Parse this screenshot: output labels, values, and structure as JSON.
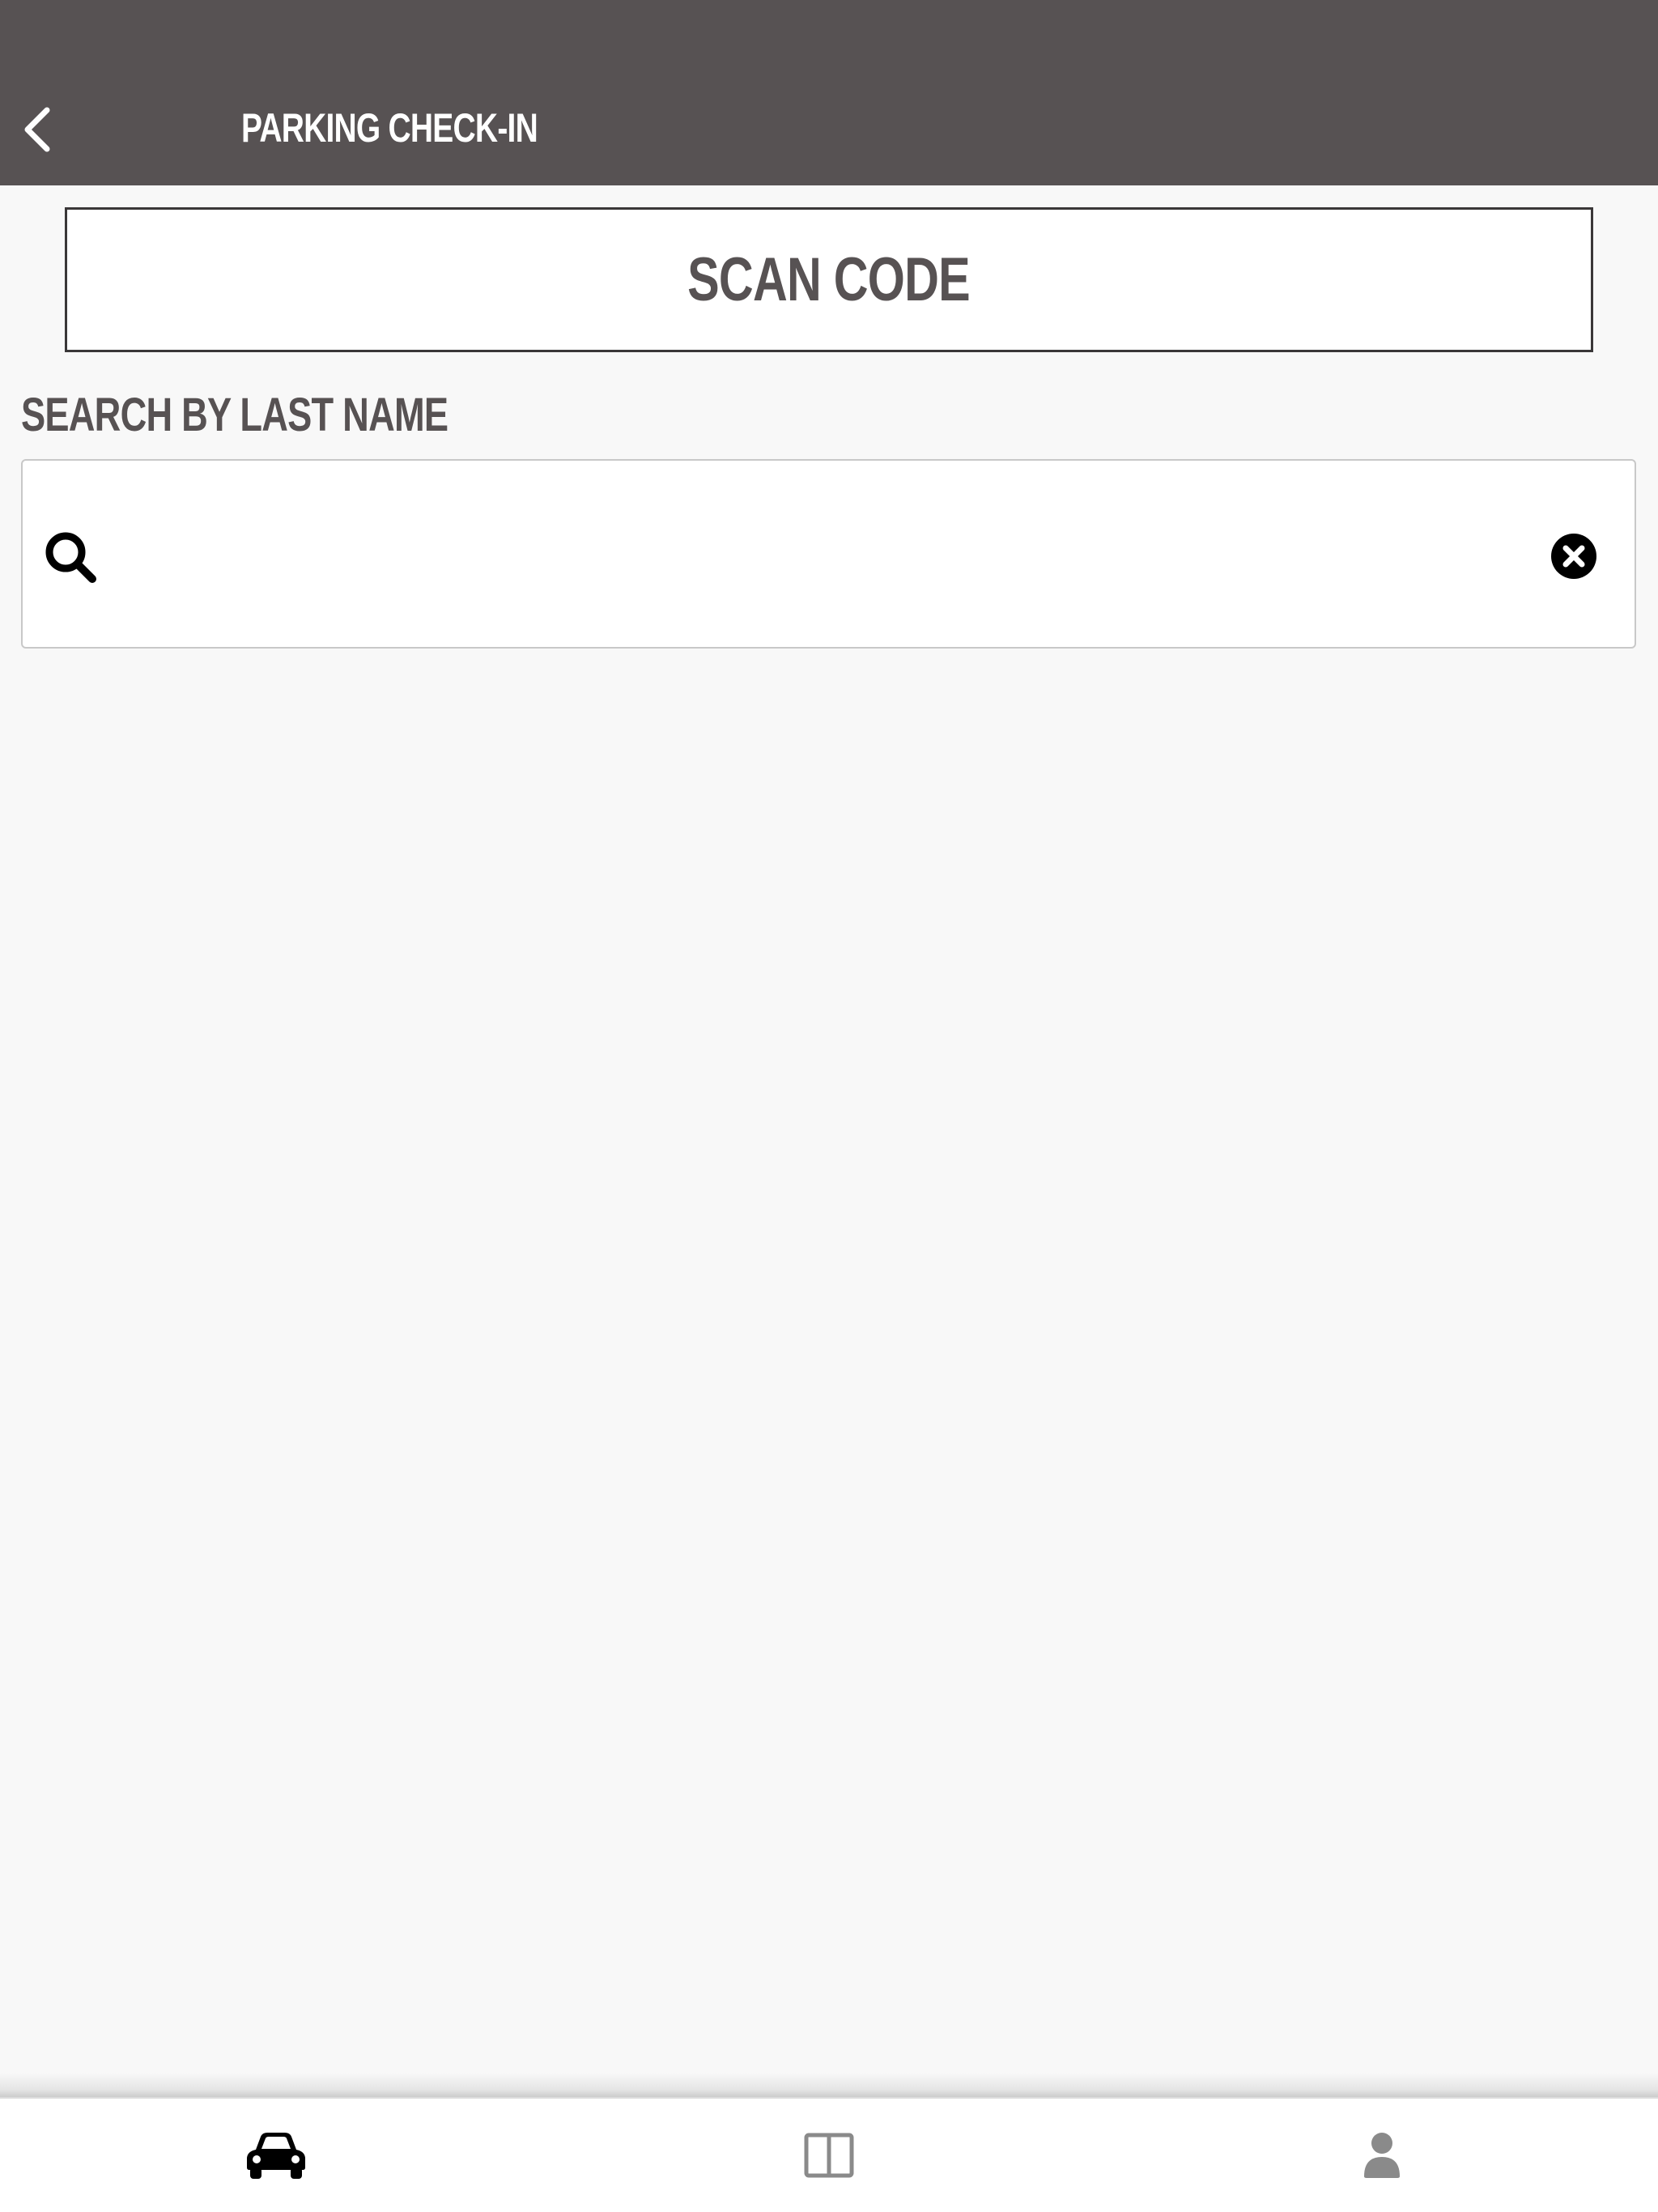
{
  "header": {
    "title": "PARKING CHECK-IN",
    "background_color": "#575253",
    "back_icon": "chevron-left-icon"
  },
  "scan": {
    "label": "SCAN CODE"
  },
  "search": {
    "section_label": "SEARCH BY LAST NAME",
    "value": "",
    "placeholder": "",
    "search_icon": "search-icon",
    "clear_icon": "clear-circle-icon"
  },
  "tabbar": {
    "tabs": [
      {
        "id": "parking",
        "icon": "car-icon",
        "active": true,
        "color": "#000000"
      },
      {
        "id": "layout",
        "icon": "columns-icon",
        "active": false,
        "color": "#8a8a8a"
      },
      {
        "id": "profile",
        "icon": "user-icon",
        "active": false,
        "color": "#8a8a8a"
      }
    ]
  },
  "colors": {
    "text_dark": "#575253",
    "page_background": "#f8f8f8"
  }
}
